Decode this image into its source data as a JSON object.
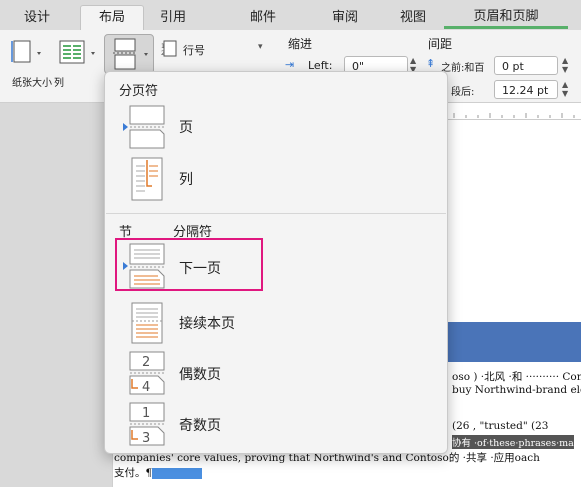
{
  "tabs": [
    "设计",
    "布局",
    "引用",
    "邮件",
    "审阅",
    "视图",
    "页眉和页脚"
  ],
  "ribbon": {
    "size_label": "纸张大小",
    "columns_label": "列",
    "line_numbers": "行号",
    "indent_title": "缩进",
    "left_label": "Left:",
    "left_value": "0\"",
    "spacing_title": "间距",
    "before_label": "之前:和百",
    "before_value": "0 pt",
    "after_label": "段后:",
    "after_value": "12.24 pt"
  },
  "menu": {
    "section1_title": "分页符",
    "page_label": "页",
    "column_label": "列",
    "section2_left": "节",
    "section2_title": "分隔符",
    "next_page_label": "下一页",
    "continuous_label": "接续本页",
    "even_page_label": "偶数页",
    "odd_page_label": "奇数页"
  },
  "doc": {
    "line1": "oso ) ·北风 ·和 ·········· Contoso",
    "line2": "buy Northwind-brand electro",
    "line3": "(26 , \"trusted\" (23",
    "line4": "协有 ·of·these·phrases·ma",
    "line5": "companies' core values, proving that Northwind's and Contoso的 ·共享 ·应用oach",
    "line6": "支付。¶"
  },
  "colors": {
    "highlight": "#e0177f",
    "accent": "#3a7bd5",
    "orange": "#e07a2a",
    "green": "#58b06a"
  }
}
